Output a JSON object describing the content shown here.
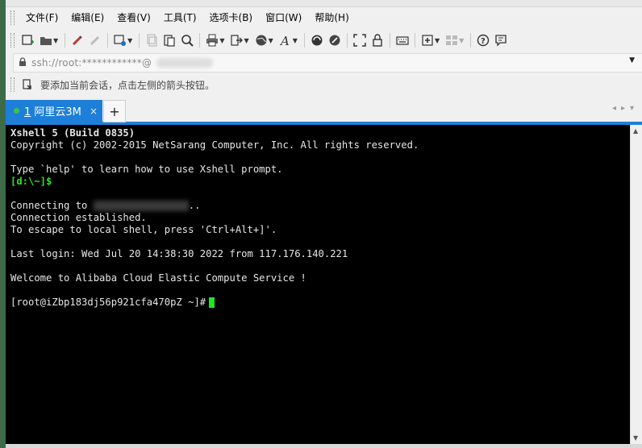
{
  "menu": {
    "items": [
      "文件(F)",
      "编辑(E)",
      "查看(V)",
      "工具(T)",
      "选项卡(B)",
      "窗口(W)",
      "帮助(H)"
    ]
  },
  "toolbar": {
    "icons": [
      "new-session-icon",
      "open-folder-icon",
      "reconnect-icon",
      "disconnect-icon",
      "properties-icon",
      "copy-icon",
      "paste-icon",
      "find-icon",
      "print-icon",
      "transfer-icon",
      "globe-icon",
      "font-icon",
      "xftp-icon",
      "xshell-icon",
      "fullscreen-icon",
      "lock-icon",
      "keyboard-icon",
      "add-icon",
      "layout-icon",
      "help-icon",
      "chat-icon"
    ]
  },
  "address": {
    "value": "ssh://root:************@"
  },
  "hint": {
    "text": "要添加当前会话，点击左侧的箭头按钮。"
  },
  "tabs": [
    {
      "number": "1",
      "label": " 阿里云3M",
      "status_color": "#3ec24a"
    }
  ],
  "new_tab_label": "+",
  "close_label": "×",
  "terminal": {
    "lines": {
      "l1": "Xshell 5 (Build 0835)",
      "l2": "Copyright (c) 2002-2015 NetSarang Computer, Inc. All rights reserved.",
      "l3": "Type `help' to learn how to use Xshell prompt.",
      "l4": "[d:\\~]$",
      "l5a": "Connecting to ",
      "l5b": "..",
      "l6": "Connection established.",
      "l7": "To escape to local shell, press 'Ctrl+Alt+]'.",
      "l8": "Last login: Wed Jul 20 14:38:30 2022 from 117.176.140.221",
      "l9": "Welcome to Alibaba Cloud Elastic Compute Service !",
      "l10": "[root@iZbp183dj56p921cfa470pZ ~]#"
    },
    "accent": "#2fe02f"
  }
}
